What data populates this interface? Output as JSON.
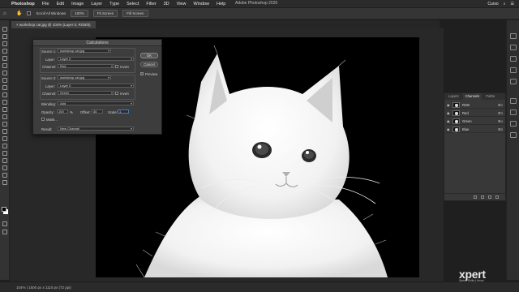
{
  "menubar": {
    "app": "Photoshop",
    "items": [
      "File",
      "Edit",
      "Image",
      "Layer",
      "Type",
      "Select",
      "Filter",
      "3D",
      "View",
      "Window",
      "Help"
    ],
    "window_title": "Adobe Photoshop 2020",
    "right_items": [
      "Curso",
      "",
      ""
    ]
  },
  "options_bar": {
    "scroll_all_windows": "Scroll All Windows",
    "zoom_100": "100%",
    "fit_screen": "Fit Screen",
    "fill_screen": "Fill Screen"
  },
  "document": {
    "tab_label": "× workshop cat.jpg @ 104% (Layer 0, RGB/8)"
  },
  "dialog": {
    "title": "Calculations",
    "source1_label": "Source 1:",
    "source1_value": "workshop cat.jpg",
    "layer_label": "Layer:",
    "layer1_value": "Layer 0",
    "channel_label": "Channel:",
    "channel1_value": "Red",
    "invert_label": "Invert",
    "source2_label": "Source 2:",
    "source2_value": "workshop cat.jpg",
    "layer2_value": "Layer 0",
    "channel2_value": "Green",
    "blending_label": "Blending:",
    "blending_value": "Add",
    "opacity_label": "Opacity:",
    "opacity_value": "100",
    "percent": "%",
    "offset_label": "Offset:",
    "offset_value": "40",
    "scale_label": "Scale:",
    "scale_value": "1",
    "mask_label": "Mask...",
    "result_label": "Result:",
    "result_value": "New Channel",
    "ok": "OK",
    "cancel": "Cancel",
    "preview": "Preview"
  },
  "channels_panel": {
    "tabs": [
      "Layers",
      "Channels",
      "Paths"
    ],
    "rows": [
      {
        "name": "RGB",
        "key": "⌘2"
      },
      {
        "name": "Red",
        "key": "⌘3"
      },
      {
        "name": "Green",
        "key": "⌘4"
      },
      {
        "name": "Blue",
        "key": "⌘5"
      }
    ]
  },
  "status_bar": {
    "text": "104% | 1500 px x 1110 px (72 ppi)"
  },
  "watermark": {
    "brand": "xpert",
    "tagline": "Speak Skills | Know"
  }
}
